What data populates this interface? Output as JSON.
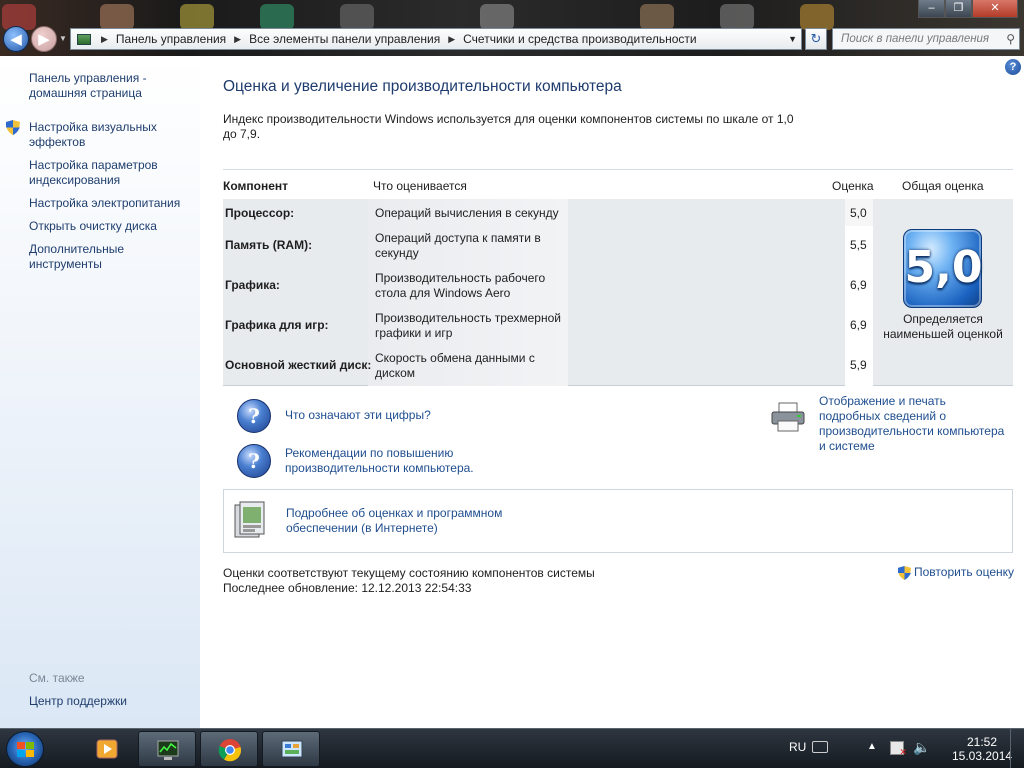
{
  "window": {
    "minimize": "‒",
    "maximize": "❐",
    "close": "✕"
  },
  "address": {
    "crumbs": [
      "Панель управления",
      "Все элементы панели управления",
      "Счетчики и средства производительности"
    ],
    "search_placeholder": "Поиск в панели управления"
  },
  "sidebar": {
    "items": [
      {
        "label": "Панель управления - домашняя страница",
        "icon": ""
      },
      {
        "label": "Настройка визуальных эффектов",
        "icon": "uac-shield-icon"
      },
      {
        "label": "Настройка параметров индексирования",
        "icon": ""
      },
      {
        "label": "Настройка электропитания",
        "icon": ""
      },
      {
        "label": "Открыть очистку диска",
        "icon": ""
      },
      {
        "label": "Дополнительные инструменты",
        "icon": ""
      }
    ],
    "see_also": "См. также",
    "support_center": "Центр поддержки"
  },
  "main": {
    "title": "Оценка и увеличение производительности компьютера",
    "description": "Индекс производительности Windows используется для оценки компонентов системы по шкале от 1,0 до 7,9.",
    "table": {
      "headers": [
        "Компонент",
        "Что оценивается",
        "Оценка",
        "Общая оценка"
      ],
      "rows": [
        {
          "component": "Процессор:",
          "measured": "Операций вычисления в секунду",
          "score": "5,0"
        },
        {
          "component": "Память (RAM):",
          "measured": "Операций доступа к памяти в секунду",
          "score": "5,5"
        },
        {
          "component": "Графика:",
          "measured": "Производительность рабочего стола для Windows Aero",
          "score": "6,9"
        },
        {
          "component": "Графика для игр:",
          "measured": "Производительность трехмерной графики и игр",
          "score": "6,9"
        },
        {
          "component": "Основной жесткий диск:",
          "measured": "Скорость обмена данными с диском",
          "score": "5,9"
        }
      ],
      "base_score": "5,0",
      "base_caption": "Определяется наименьшей оценкой"
    },
    "links": {
      "what_numbers": "Что означают эти цифры?",
      "tips": "Рекомендации по повышению производительности компьютера.",
      "print_details": "Отображение и печать подробных сведений о производительности компьютера и системе",
      "learn_more": "Подробнее об оценках и программном обеспечении (в Интернете)"
    },
    "status": "Оценки соответствуют текущему состоянию компонентов системы",
    "last_update": "Последнее обновление: 12.12.2013 22:54:33",
    "rerun": "Повторить оценку"
  },
  "taskbar": {
    "lang": "RU",
    "time": "21:52",
    "date": "15.03.2014"
  },
  "colors": {
    "link": "#1f4e8f",
    "title": "#1e3b6e",
    "accent_blue": "#1a62c0"
  }
}
